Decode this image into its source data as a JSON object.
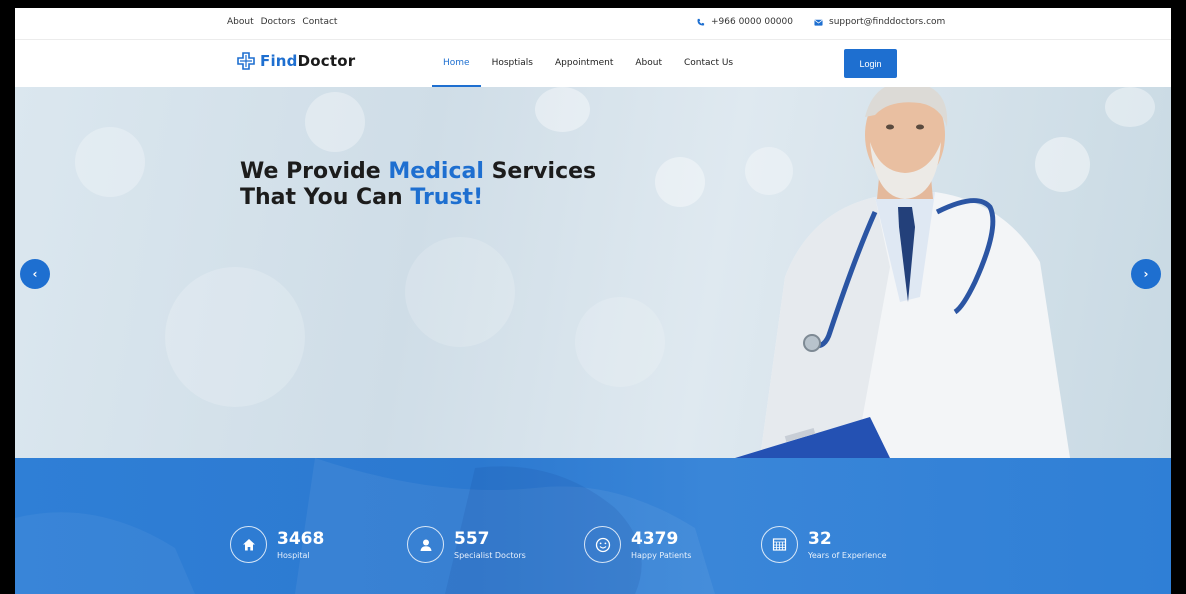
{
  "topbar": {
    "links": [
      "About",
      "Doctors",
      "Contact"
    ],
    "phone": "+966 0000 00000",
    "email": "support@finddoctors.com"
  },
  "brand": {
    "find": "Find",
    "doctor": "Doctor"
  },
  "nav": {
    "items": [
      "Home",
      "Hosptials",
      "Appointment",
      "About",
      "Contact Us"
    ],
    "active": "Home",
    "login": "Login"
  },
  "hero": {
    "line1_a": "We Provide ",
    "line1_b": "Medical",
    "line1_c": " Services",
    "line2_a": "That You Can ",
    "line2_b": "Trust!",
    "prev": "‹",
    "next": "›"
  },
  "stats": [
    {
      "number": "3468",
      "label": "Hospital",
      "icon": "home-icon"
    },
    {
      "number": "557",
      "label": "Specialist Doctors",
      "icon": "user-icon"
    },
    {
      "number": "4379",
      "label": "Happy Patients",
      "icon": "smile-icon"
    },
    {
      "number": "32",
      "label": "Years of Experience",
      "icon": "calendar-icon"
    }
  ],
  "colors": {
    "accent": "#1e6fd0",
    "stats_bg": "#2f7fd6"
  }
}
